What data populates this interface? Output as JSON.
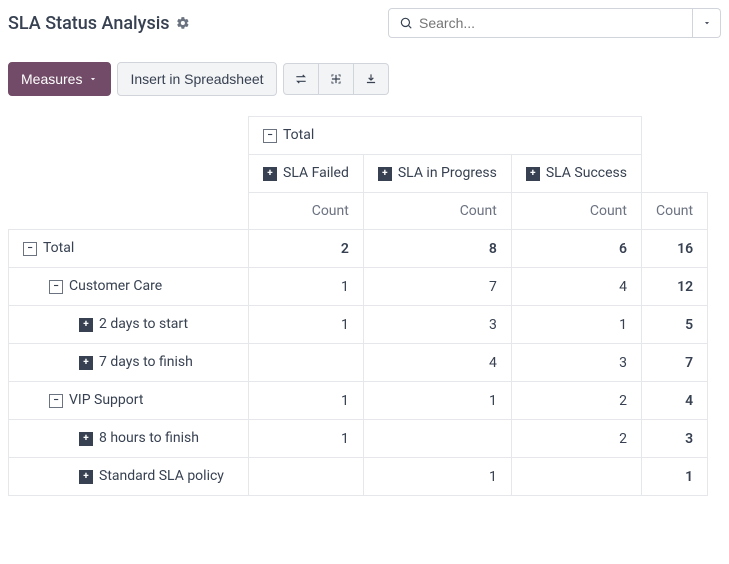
{
  "header": {
    "title": "SLA Status Analysis",
    "search_placeholder": "Search..."
  },
  "toolbar": {
    "measures": "Measures",
    "insert": "Insert in Spreadsheet"
  },
  "pivot": {
    "total_label": "Total",
    "columns": [
      "SLA Failed",
      "SLA in Progress",
      "SLA Success"
    ],
    "count_label": "Count",
    "rows": [
      {
        "label": "Total",
        "level": 0,
        "expanded": true,
        "values": [
          "2",
          "8",
          "6",
          "16"
        ],
        "bold": true
      },
      {
        "label": "Customer Care",
        "level": 1,
        "expanded": true,
        "values": [
          "1",
          "7",
          "4",
          "12"
        ],
        "bold_last": true
      },
      {
        "label": "2 days to start",
        "level": 2,
        "expanded": false,
        "values": [
          "1",
          "3",
          "1",
          "5"
        ],
        "bold_last": true
      },
      {
        "label": "7 days to finish",
        "level": 2,
        "expanded": false,
        "values": [
          "",
          "4",
          "3",
          "7"
        ],
        "bold_last": true
      },
      {
        "label": "VIP Support",
        "level": 1,
        "expanded": true,
        "values": [
          "1",
          "1",
          "2",
          "4"
        ],
        "bold_last": true
      },
      {
        "label": "8 hours to finish",
        "level": 2,
        "expanded": false,
        "values": [
          "1",
          "",
          "2",
          "3"
        ],
        "bold_last": true
      },
      {
        "label": "Standard SLA policy",
        "level": 2,
        "expanded": false,
        "values": [
          "",
          "1",
          "",
          "1"
        ],
        "bold_last": true
      }
    ]
  }
}
